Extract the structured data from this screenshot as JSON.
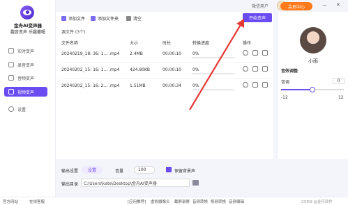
{
  "app": {
    "brand": "金舟AI变声器",
    "slogan": "趣音变声 乐趣撒喔"
  },
  "sidebar": {
    "items": [
      {
        "label": "实时变声"
      },
      {
        "label": "录音变声"
      },
      {
        "label": "音频变声"
      },
      {
        "label": "视频变声"
      },
      {
        "label": "设置"
      }
    ]
  },
  "topbar": {
    "user_label": "微信用户",
    "vip_label": "会员中心",
    "min": "—",
    "close": "✕"
  },
  "toolbar": {
    "add_file": "添加文件",
    "add_folder": "添加文件夹",
    "clear": "清空",
    "start": "开始变声"
  },
  "file_count": "源文件 (3个)",
  "table": {
    "headers": [
      "文件名称",
      "大小",
      "时长",
      "转换进度",
      "操作"
    ],
    "rows": [
      {
        "name": "20240219_18: 36: 1... .mp4",
        "size": "2.4MB",
        "duration": "00:00:10",
        "progress": "0%"
      },
      {
        "name": "20240202_15: 16: 1... .mp4",
        "size": "424.80KB",
        "duration": "00:00:10",
        "progress": "0%"
      },
      {
        "name": "20240202_15: 16: 2... .mp4",
        "size": "1.51MB",
        "duration": "00:00:34",
        "progress": "0%"
      }
    ]
  },
  "bottom": {
    "output_settings": "输出设置",
    "settings_btn": "设置",
    "volume_label": "音量",
    "volume_value": "100",
    "keep_bg": "保留背景声",
    "output_dir_label": "输出目录",
    "output_dir": "C:\\Users\\kate\\Desktop\\金舟AI变声器"
  },
  "right": {
    "voice_name": "小雨",
    "adjust_title": "音效调整",
    "pitch_label": "音调",
    "pitch_value": "0",
    "pitch_min": "-12",
    "pitch_max": "12"
  },
  "status": {
    "items": [
      "官方网站",
      "在线客服",
      "[应用推荐]",
      "虚拟摄像头",
      "截屏录屏",
      "音频转换",
      "视频转换",
      "音频编辑"
    ],
    "watermark": "CSDN @金舟软件"
  },
  "colors": {
    "accent": "#6a4cf0",
    "vip": "#ff7a1a",
    "arrow": "#e53935"
  }
}
